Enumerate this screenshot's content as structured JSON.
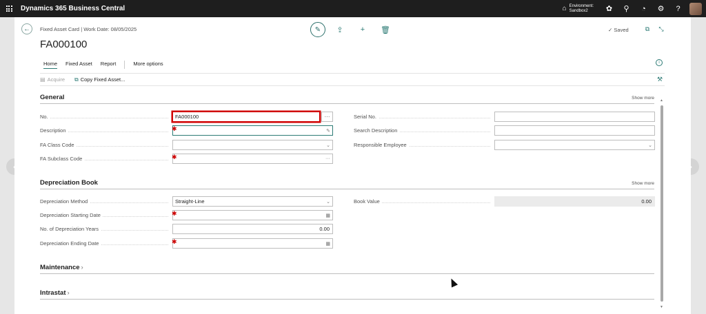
{
  "app": {
    "title": "Dynamics 365 Business Central"
  },
  "environment": {
    "line1": "Environment:",
    "line2": "Sandbox2"
  },
  "header": {
    "breadcrumb": "Fixed Asset Card | Work Date: 08/05/2025",
    "title": "FA000100",
    "saved": "Saved"
  },
  "tabs": [
    "Home",
    "Fixed Asset",
    "Report",
    "More options"
  ],
  "subactions": {
    "acquire": "Acquire",
    "copy": "Copy Fixed Asset..."
  },
  "general": {
    "title": "General",
    "show_more": "Show more",
    "no_label": "No.",
    "no_value": "FA000100",
    "no_assist": "···",
    "description_label": "Description",
    "fa_class_label": "FA Class Code",
    "fa_subclass_label": "FA Subclass Code",
    "fa_subclass_suffix": "···",
    "serial_label": "Serial No.",
    "search_desc_label": "Search Description",
    "responsible_label": "Responsible Employee"
  },
  "depreciation": {
    "title": "Depreciation Book",
    "show_more": "Show more",
    "method_label": "Depreciation Method",
    "method_value": "Straight-Line",
    "start_label": "Depreciation Starting Date",
    "years_label": "No. of Depreciation Years",
    "years_value": "0.00",
    "end_label": "Depreciation Ending Date",
    "book_value_label": "Book Value",
    "book_value": "0.00"
  },
  "maintenance": {
    "title": "Maintenance"
  },
  "intrastat": {
    "title": "Intrastat"
  },
  "colors": {
    "accent": "#2b7a74",
    "topbar": "#1e1e1e",
    "required": "#cc0000",
    "highlight": "#d00000"
  }
}
